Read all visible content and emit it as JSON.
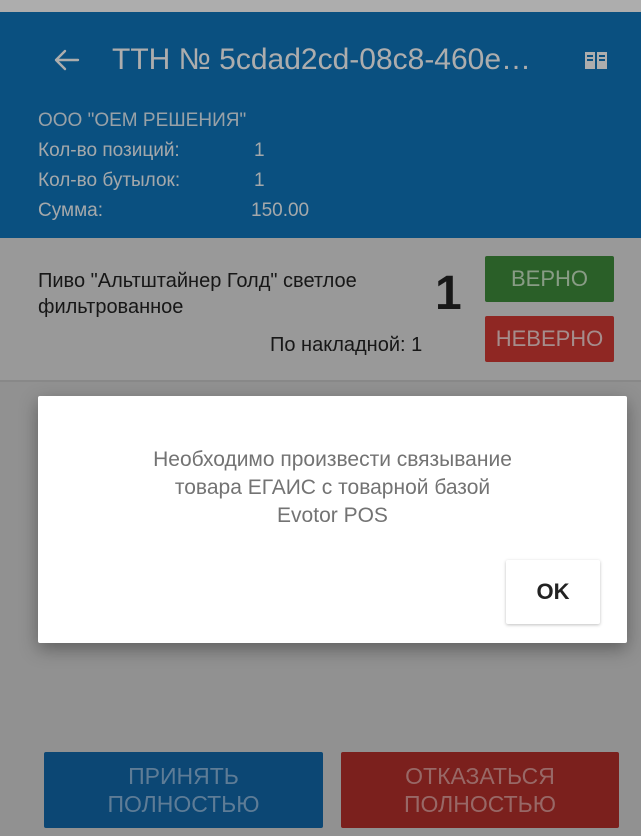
{
  "header": {
    "title": "ТТН № 5cdad2cd-08c8-460e…",
    "back_icon": "arrow-left-icon",
    "book_icon": "book-icon",
    "background_color": "#0f76bd"
  },
  "summary": {
    "organization": "ООО \"ОЕМ РЕШЕНИЯ\"",
    "positions_label": "Кол-во позиций:",
    "positions_value": "1",
    "bottles_label": "Кол-во бутылок:",
    "bottles_value": "1",
    "sum_label": "Сумма:",
    "sum_value": "150.00"
  },
  "item": {
    "name": "Пиво \"Альтштайнер Голд\" светлое фильтрованное",
    "quantity": "1",
    "waybill_text": "По накладной: 1",
    "correct_label": "ВЕРНО",
    "wrong_label": "НЕВЕРНО"
  },
  "footer": {
    "accept_line1": "ПРИНЯТЬ",
    "accept_line2": "ПОЛНОСТЬЮ",
    "reject_line1": "ОТКАЗАТЬСЯ",
    "reject_line2": "ПОЛНОСТЬЮ"
  },
  "dialog": {
    "line1": "Необходимо произвести связывание",
    "line2": "товара ЕГАИС с товарной базой",
    "line3": "Evotor POS",
    "ok_label": "OK"
  },
  "colors": {
    "accept": "#1269ac",
    "reject": "#b5302b",
    "correct": "#3f8c3b",
    "wrong": "#d33a34"
  }
}
